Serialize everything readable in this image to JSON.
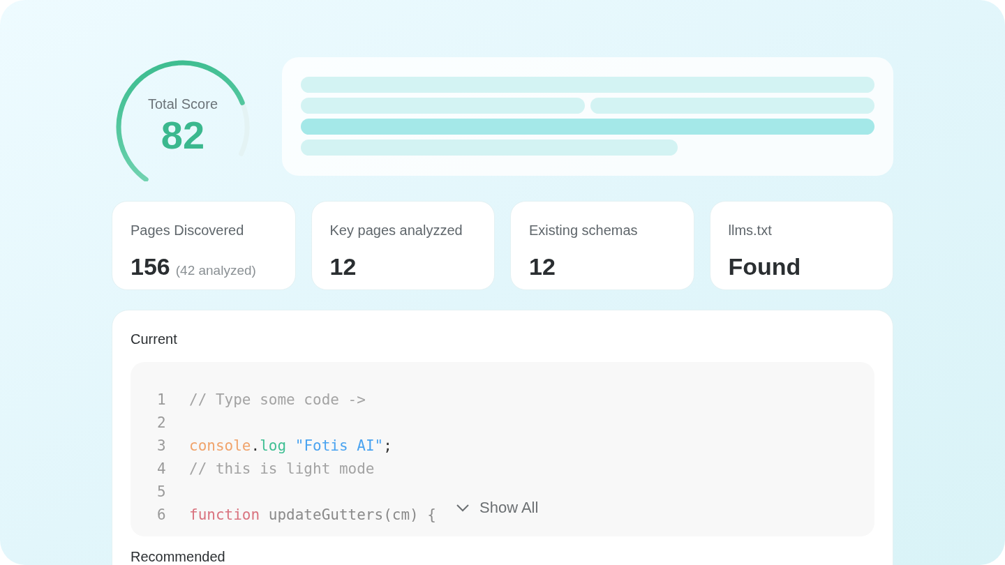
{
  "score": {
    "label": "Total Score",
    "value": "82",
    "level": 0.82
  },
  "stats": [
    {
      "label": "Pages Discovered",
      "value": "156",
      "note": "(42 analyzed)"
    },
    {
      "label": "Key pages analyzzed",
      "value": "12"
    },
    {
      "label": "Existing schemas",
      "value": "12"
    },
    {
      "label": "llms.txt",
      "value": "Found"
    }
  ],
  "current": {
    "title": "Current",
    "lines": [
      {
        "number": "1",
        "tokens": [
          {
            "kind": "comment",
            "text": "// Type some code ->"
          }
        ]
      },
      {
        "number": "2"
      },
      {
        "number": "3",
        "tokens": [
          {
            "kind": "object",
            "text": "console"
          },
          {
            "kind": "plain",
            "text": "."
          },
          {
            "kind": "method",
            "text": "log"
          },
          {
            "kind": "string",
            "text": " \"Fotis AI\""
          },
          {
            "kind": "plain",
            "text": ";"
          }
        ]
      },
      {
        "number": "4",
        "tokens": [
          {
            "kind": "comment",
            "text": "// this is light mode"
          }
        ]
      },
      {
        "number": "5"
      },
      {
        "number": "6",
        "tokens": [
          {
            "kind": "keyword",
            "text": "function"
          },
          {
            "kind": "name",
            "text": " updateGutters(cm) {"
          }
        ]
      }
    ],
    "show_all": "Show All"
  },
  "recommended": {
    "title": "Recommended"
  }
}
